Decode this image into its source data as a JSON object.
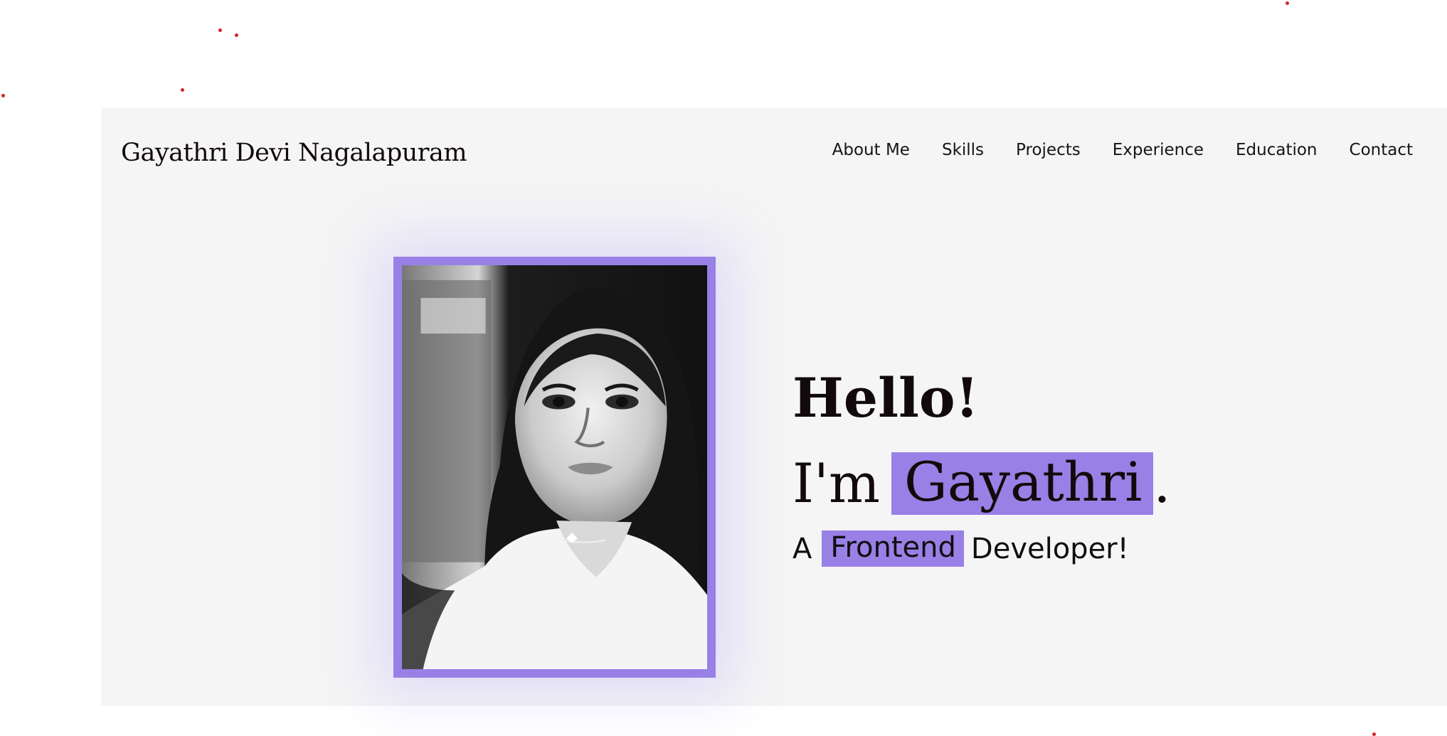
{
  "header": {
    "brand_name": "Gayathri Devi Nagalapuram",
    "nav_items": [
      {
        "label": "About Me"
      },
      {
        "label": "Skills"
      },
      {
        "label": "Projects"
      },
      {
        "label": "Experience"
      },
      {
        "label": "Education"
      },
      {
        "label": "Contact"
      }
    ]
  },
  "hero": {
    "greeting": "Hello!",
    "intro_prefix": "I'm",
    "intro_name": "Gayathri",
    "intro_suffix": ".",
    "role_prefix": "A",
    "role_highlight": "Frontend",
    "role_suffix": "Developer!"
  },
  "colors": {
    "accent": "#9880e6",
    "background": "#f5f5f5",
    "text": "#120a0a",
    "dots": "#d42424"
  }
}
